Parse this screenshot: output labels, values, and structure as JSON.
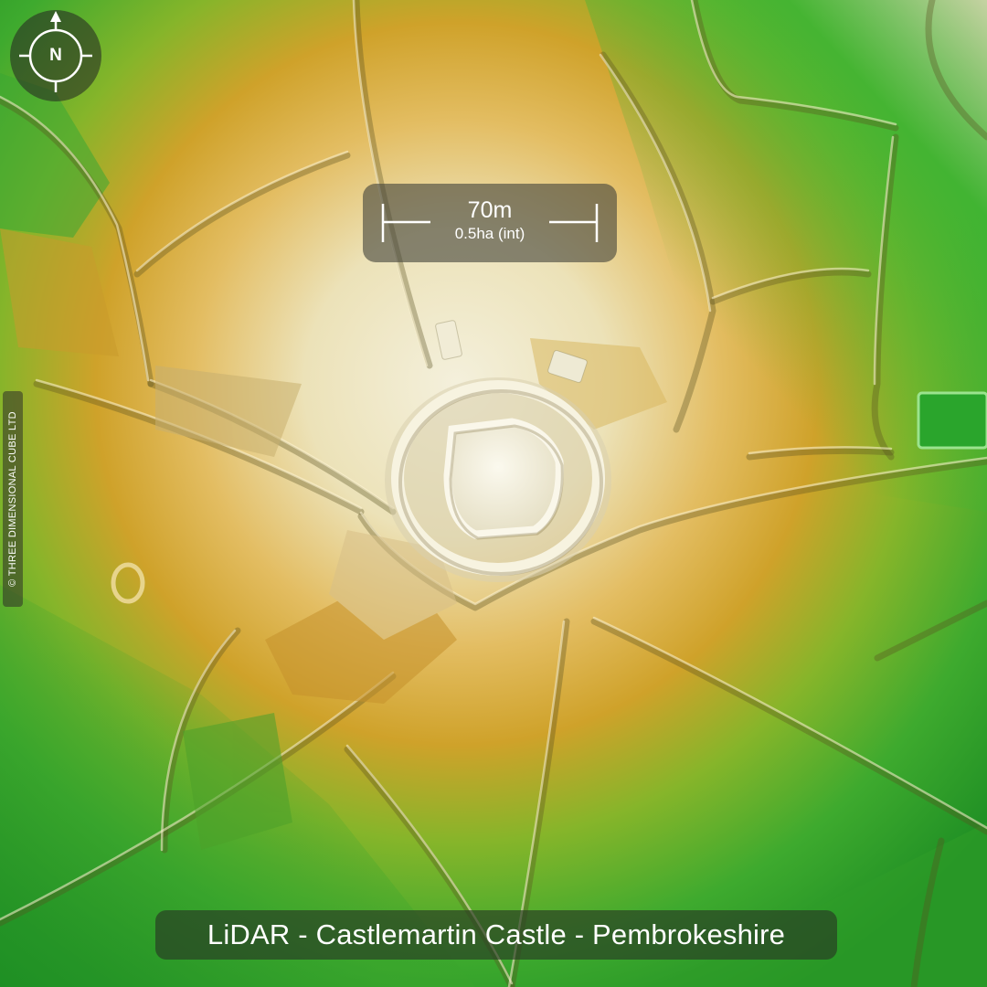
{
  "map": {
    "title": "LiDAR - Castlemartin Castle - Pembrokeshire",
    "north_label": "N",
    "scale": {
      "distance": "70m",
      "area": "0.5ha (int)"
    },
    "copyright": "© THREE DIMENSIONAL CUBE LTD",
    "elevation_colors": {
      "low": "#2fae2c",
      "mid": "#d9a32e",
      "high": "#f0ead2"
    }
  }
}
